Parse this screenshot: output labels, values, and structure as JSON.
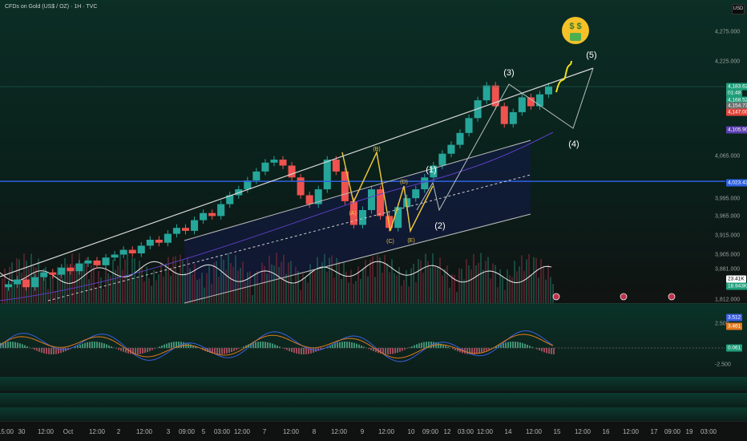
{
  "header": {
    "title": "CFDs on Gold (US$ / OZ) · 1H · TVC",
    "currency": "USD"
  },
  "chart_data": {
    "type": "candlestick",
    "title": "CFDs on Gold (US$ / OZ) · 1H · TVC",
    "y_axis_labels": [
      "4,275.000",
      "4,225.000",
      "4,065.000",
      "3,995.000",
      "3,965.000",
      "3,915.000",
      "3,905.000",
      "3,881.000",
      "1,812.000"
    ],
    "ylim": [
      3830,
      4285
    ],
    "x_tick_labels": [
      "15:00",
      "30",
      "12:00",
      "Oct",
      "12:00",
      "2",
      "12:00",
      "3",
      "09:00",
      "5",
      "03:00",
      "12:00",
      "7",
      "12:00",
      "8",
      "12:00",
      "9",
      "12:00",
      "10",
      "09:00",
      "12",
      "03:00",
      "12:00",
      "14",
      "12:00",
      "15",
      "12:00",
      "16",
      "12:00",
      "17",
      "09:00",
      "19",
      "03:00"
    ],
    "closes": [
      3850,
      3858,
      3845,
      3862,
      3870,
      3866,
      3878,
      3872,
      3885,
      3890,
      3882,
      3895,
      3900,
      3908,
      3902,
      3915,
      3925,
      3920,
      3935,
      3945,
      3940,
      3958,
      3970,
      3965,
      3985,
      4000,
      4010,
      4025,
      4040,
      4055,
      4060,
      4050,
      4030,
      4000,
      3985,
      4010,
      4060,
      4040,
      3990,
      3950,
      3975,
      4010,
      3965,
      3945,
      3980,
      3995,
      4010,
      4030,
      4050,
      4070,
      4085,
      4105,
      4130,
      4160,
      4185,
      4150,
      4120,
      4140,
      4165,
      4150,
      4170,
      4183.6
    ],
    "price_tags": [
      {
        "label": "4,183.620",
        "color": "#1e9e7a",
        "value": 4183.62
      },
      {
        "label": "01:48",
        "color": "#1e9e7a",
        "value": 4176
      },
      {
        "label": "4,168.520",
        "color": "#1e9e7a",
        "value": 4168.52
      },
      {
        "label": "4,154.737",
        "color": "#6b6f6e",
        "value": 4154.737
      },
      {
        "label": "4,147.002",
        "color": "#e0453a",
        "value": 4147.002
      },
      {
        "label": "4,105.902",
        "color": "#5b3fb0",
        "value": 4105.902
      },
      {
        "label": "4,023.430",
        "color": "#2e62e0",
        "value": 4023.43
      }
    ],
    "horizontal_line": {
      "value": 4023.43,
      "color": "#2e62e0"
    },
    "wave_labels": [
      "(A)",
      "(B)",
      "(C)",
      "(D)",
      "(E)",
      "(1)",
      "(2)",
      "(3)",
      "(4)",
      "(5)"
    ],
    "volume_tags": [
      {
        "label": "23.41K",
        "color": "#ffffff",
        "text": "#000"
      },
      {
        "label": "18.943K",
        "color": "#1e9e7a",
        "text": "#fff"
      }
    ],
    "indicator": {
      "axis_labels": [
        "2.500",
        "-2.500"
      ],
      "tags": [
        {
          "label": "3.512",
          "color": "#3a5fe0"
        },
        {
          "label": "3.461",
          "color": "#e07a1e"
        },
        {
          "label": "0.061",
          "color": "#1e9e7a"
        }
      ]
    },
    "emoji": "money-mouth-face"
  }
}
